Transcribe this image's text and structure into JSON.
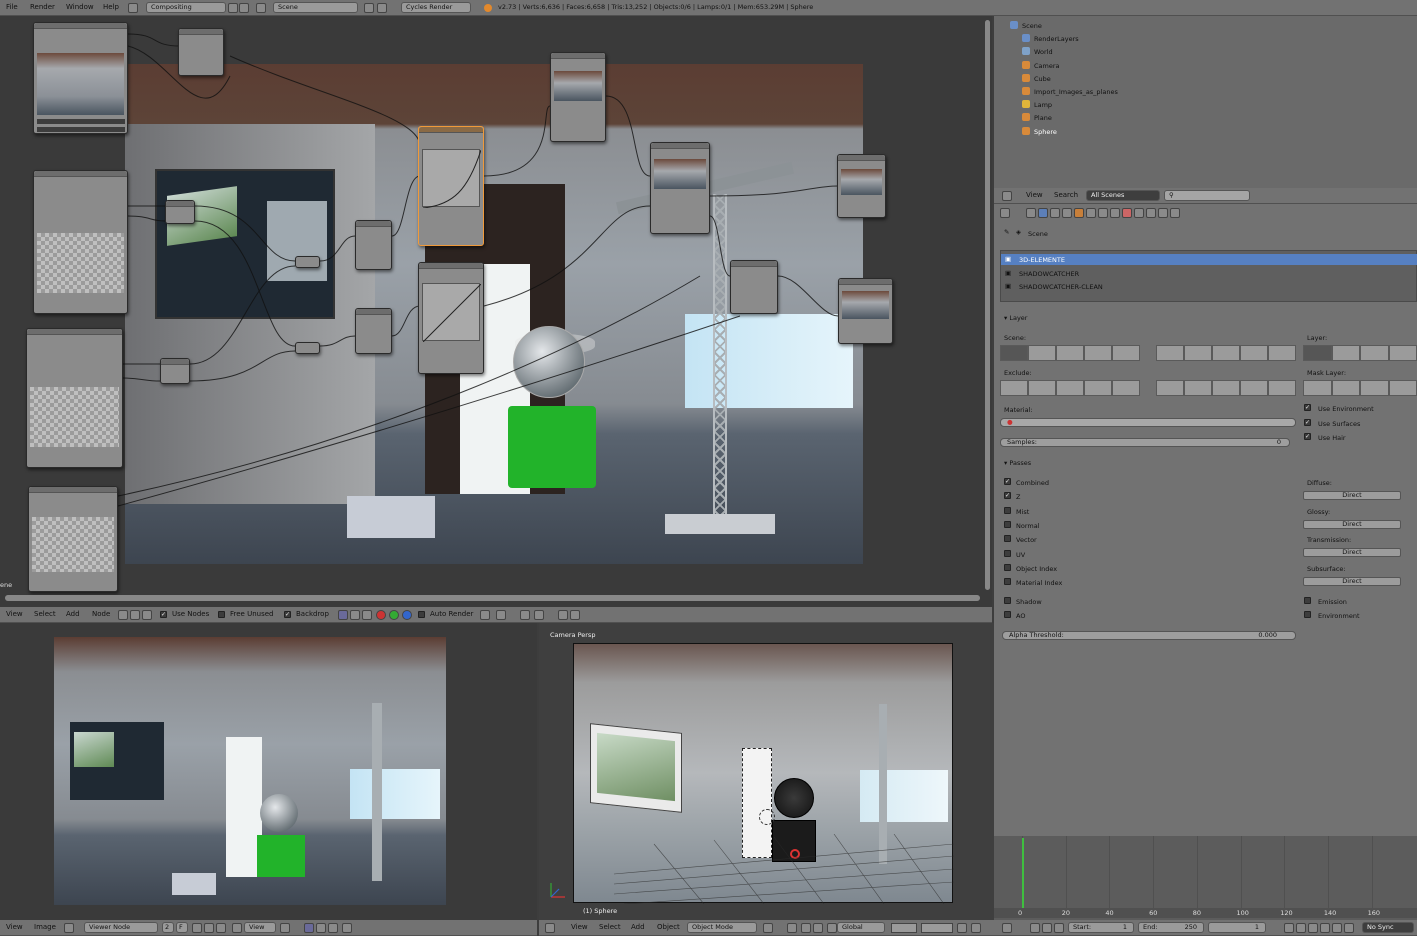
{
  "top_bar": {
    "menus": [
      "File",
      "Render",
      "Window",
      "Help"
    ],
    "screen_layout": "Compositing",
    "scene": "Scene",
    "render_engine": "Cycles Render",
    "stats": "v2.73 | Verts:6,636 | Faces:6,658 | Tris:13,252 | Objects:0/6 | Lamps:0/1 | Mem:653.29M | Sphere"
  },
  "outliner": {
    "items": [
      {
        "label": "Scene"
      },
      {
        "label": "RenderLayers"
      },
      {
        "label": "World"
      },
      {
        "label": "Camera"
      },
      {
        "label": "Cube"
      },
      {
        "label": "Import_Images_as_planes"
      },
      {
        "label": "Lamp"
      },
      {
        "label": "Plane"
      },
      {
        "label": "Sphere"
      }
    ],
    "header": {
      "view": "View",
      "search": "Search",
      "filter": "All Scenes"
    }
  },
  "properties": {
    "breadcrumb": "Scene",
    "render_layers": [
      "3D-ELEMENTE",
      "SHADOWCATCHER",
      "SHADOWCATCHER-CLEAN"
    ],
    "layer_section": "Layer",
    "scene_label": "Scene:",
    "layer_label": "Layer:",
    "exclude_label": "Exclude:",
    "mask_layer_label": "Mask Layer:",
    "material_label": "Material:",
    "use_environment": "Use Environment",
    "use_surfaces": "Use Surfaces",
    "use_hair": "Use Hair",
    "samples_label": "Samples:",
    "samples_value": "0",
    "passes_section": "Passes",
    "passes_left": [
      {
        "label": "Combined",
        "checked": true
      },
      {
        "label": "Z",
        "checked": true
      },
      {
        "label": "Mist",
        "checked": false
      },
      {
        "label": "Normal",
        "checked": false
      },
      {
        "label": "Vector",
        "checked": false
      },
      {
        "label": "UV",
        "checked": false
      },
      {
        "label": "Object Index",
        "checked": false
      },
      {
        "label": "Material Index",
        "checked": false
      }
    ],
    "passes_right": [
      {
        "label": "Diffuse:",
        "button": "Direct"
      },
      {
        "label": "Glossy:",
        "button": "Direct"
      },
      {
        "label": "Transmission:",
        "button": "Direct"
      },
      {
        "label": "Subsurface:",
        "button": "Direct"
      }
    ],
    "shadow": "Shadow",
    "ao": "AO",
    "emission": "Emission",
    "environment": "Environment",
    "alpha_threshold_label": "Alpha Threshold:",
    "alpha_threshold_value": "0.000"
  },
  "node_editor": {
    "header": {
      "menus": [
        "View",
        "Select",
        "Add",
        "Node"
      ],
      "use_nodes": "Use Nodes",
      "free_unused": "Free Unused",
      "backdrop": "Backdrop",
      "auto_render": "Auto Render"
    },
    "left_edge_label": "ene"
  },
  "image_editor": {
    "header": {
      "menus": [
        "View",
        "Image"
      ],
      "image": "Viewer Node",
      "slot": "2",
      "slot_f": "F",
      "view": "View"
    }
  },
  "viewport": {
    "label": "Camera Persp",
    "object_label": "(1) Sphere",
    "header": {
      "menus": [
        "View",
        "Select",
        "Add",
        "Object"
      ],
      "mode": "Object Mode",
      "orientation": "Global"
    }
  },
  "timeline": {
    "ticks": [
      "0",
      "20",
      "40",
      "60",
      "80",
      "100",
      "120",
      "140",
      "160"
    ],
    "start_label": "Start:",
    "start_value": "1",
    "end_label": "End:",
    "end_value": "250",
    "current": "1",
    "sync": "No Sync"
  }
}
